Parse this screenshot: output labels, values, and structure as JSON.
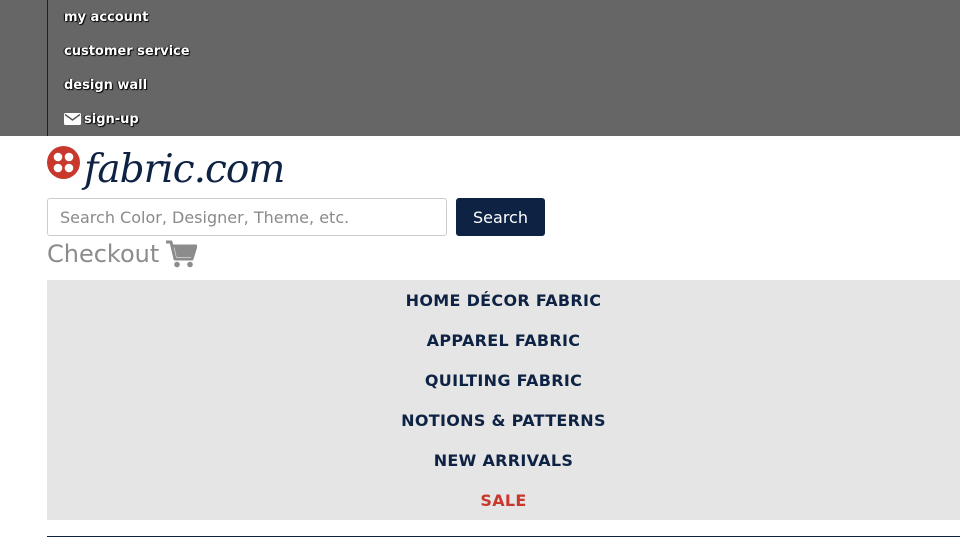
{
  "topbar": {
    "items": [
      {
        "label": "my account",
        "icon": ""
      },
      {
        "label": "customer service",
        "icon": ""
      },
      {
        "label": "design wall",
        "icon": ""
      },
      {
        "label": "sign-up",
        "icon": "envelope-icon"
      }
    ]
  },
  "logo": {
    "wordmark": "fabric.com",
    "mark_color": "#c8382c",
    "wordmark_color": "#0e2244"
  },
  "search": {
    "placeholder": "Search Color, Designer, Theme, etc.",
    "value": "",
    "button_label": "Search"
  },
  "checkout": {
    "label": "Checkout",
    "icon": "cart-icon"
  },
  "main_nav": {
    "items": [
      {
        "label": "HOME DÉCOR FABRIC"
      },
      {
        "label": "APPAREL FABRIC"
      },
      {
        "label": "QUILTING FABRIC"
      },
      {
        "label": "NOTIONS & PATTERNS"
      },
      {
        "label": "NEW ARRIVALS"
      },
      {
        "label": "SALE"
      }
    ]
  },
  "colors": {
    "topbar_bg": "#666666",
    "brand_navy": "#0e2244",
    "sale_red": "#c8382c",
    "nav_bg": "#e5e5e5"
  }
}
